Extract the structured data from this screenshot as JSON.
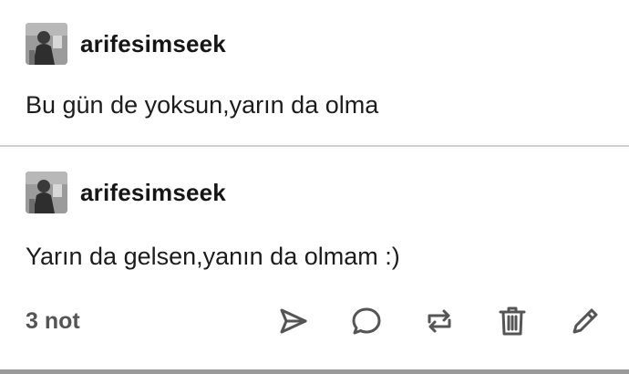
{
  "posts": [
    {
      "username": "arifesimseek",
      "text": "Bu gün de yoksun,yarın da olma"
    },
    {
      "username": "arifesimseek",
      "text": "Yarın da gelsen,yanın da olmam :)",
      "notes": "3 not"
    }
  ],
  "actions": [
    {
      "icon": "send-icon"
    },
    {
      "icon": "comment-icon"
    },
    {
      "icon": "reblog-icon"
    },
    {
      "icon": "delete-icon"
    },
    {
      "icon": "edit-icon"
    }
  ],
  "colors": {
    "text": "#1a1a1a",
    "muted": "#555555",
    "divider": "#cfcfcf"
  }
}
